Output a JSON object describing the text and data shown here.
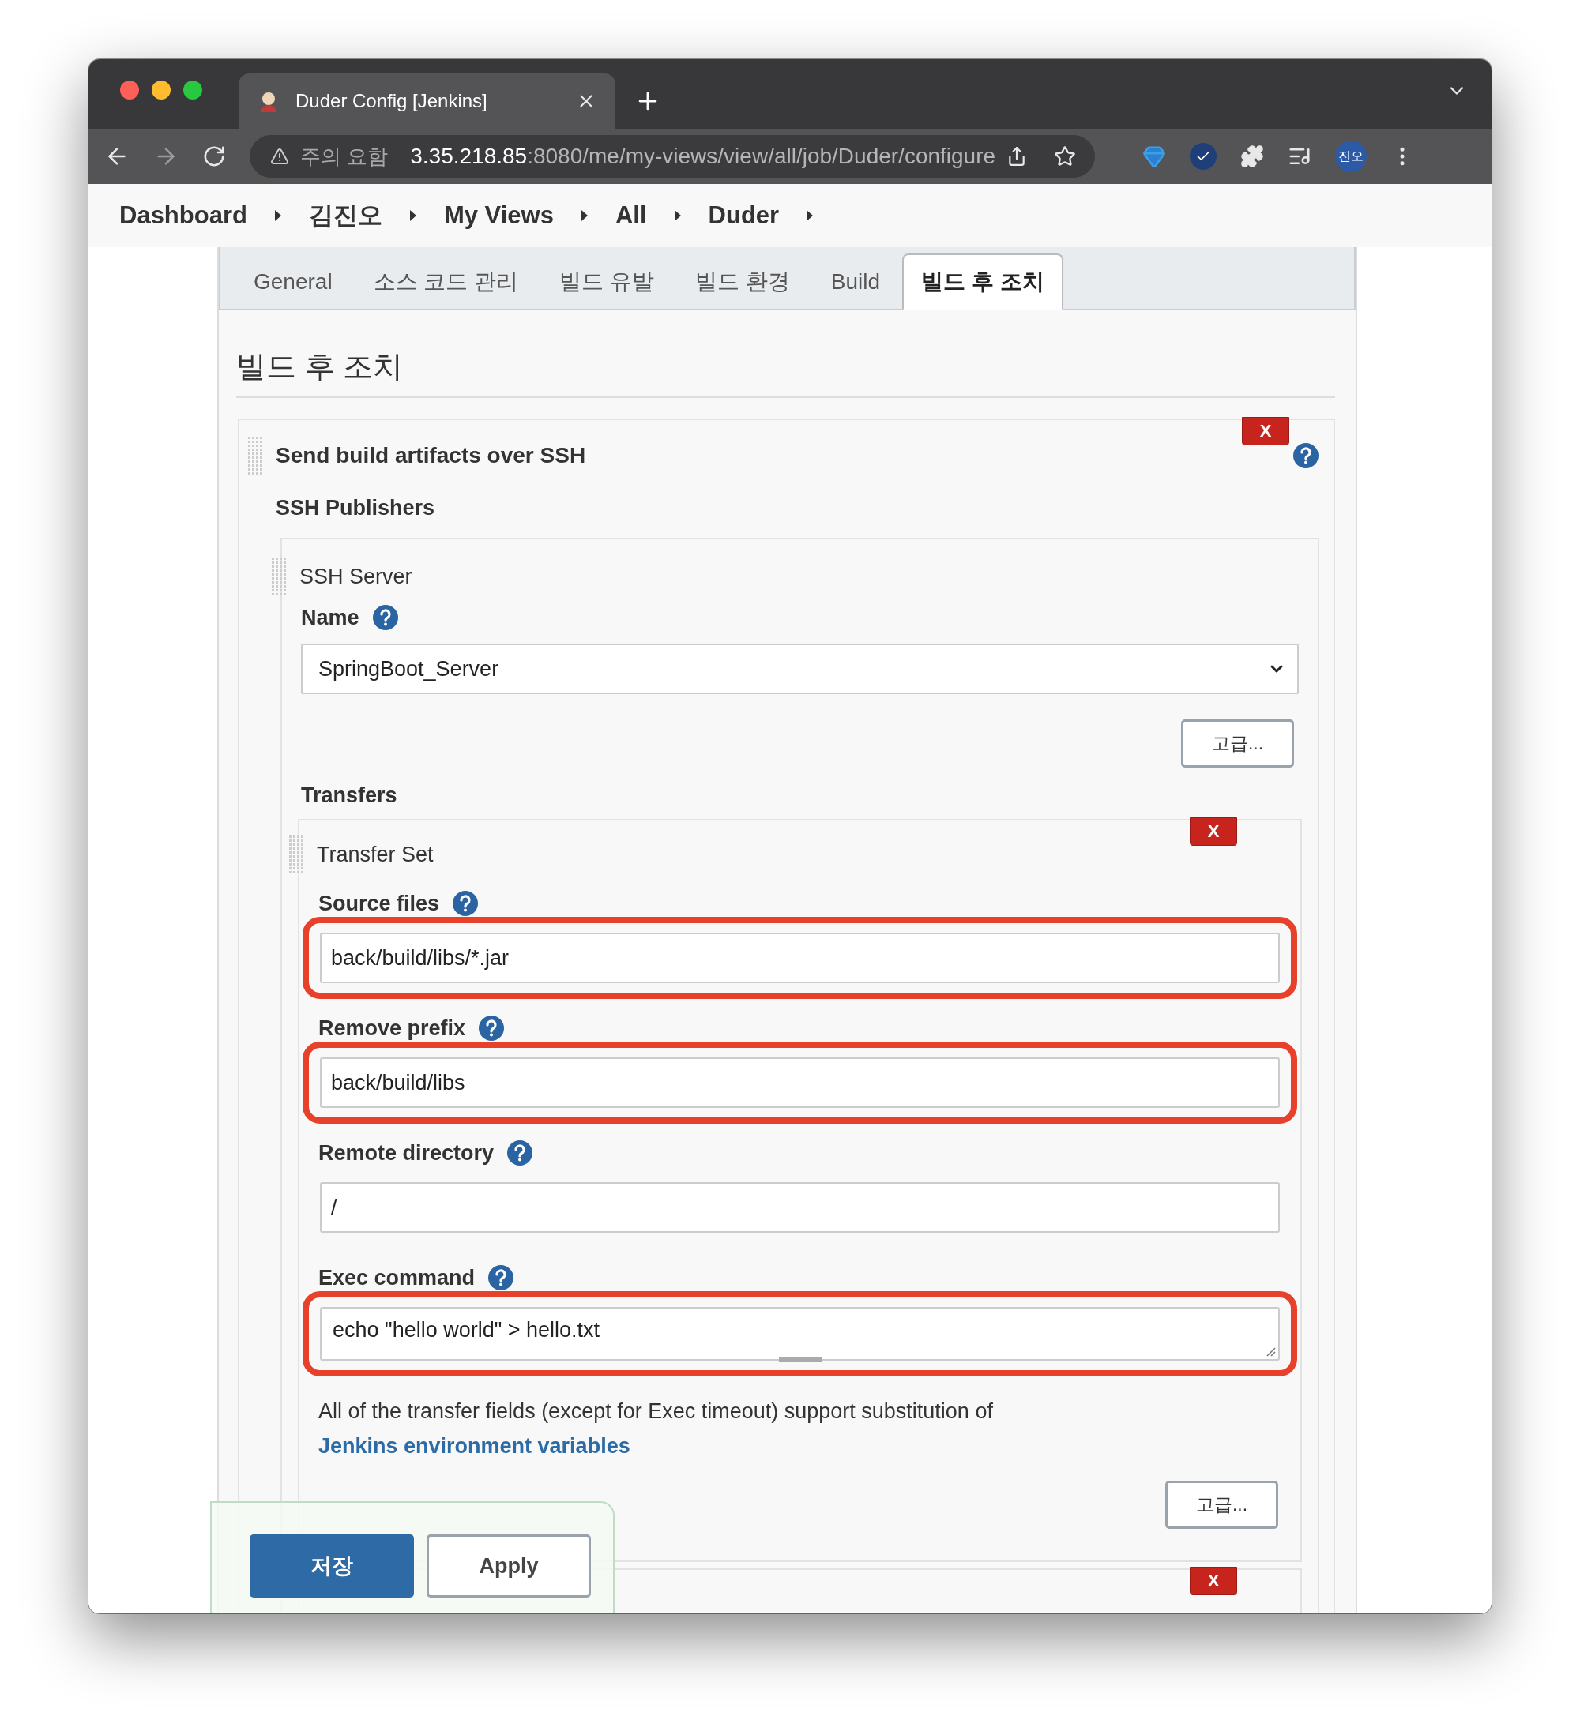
{
  "browser": {
    "tab_title": "Duder Config [Jenkins]",
    "security_label": "주의 요함",
    "url_host": "3.35.218.85",
    "url_path": ":8080/me/my-views/view/all/job/Duder/configure",
    "profile": "진오"
  },
  "breadcrumbs": [
    "Dashboard",
    "김진오",
    "My Views",
    "All",
    "Duder"
  ],
  "tabs": [
    {
      "label": "General",
      "selected": false
    },
    {
      "label": "소스 코드 관리",
      "selected": false
    },
    {
      "label": "빌드 유발",
      "selected": false
    },
    {
      "label": "빌드 환경",
      "selected": false
    },
    {
      "label": "Build",
      "selected": false
    },
    {
      "label": "빌드 후 조치",
      "selected": true
    }
  ],
  "heading": "빌드 후 조치",
  "publisher": {
    "title": "Send build artifacts over SSH",
    "delete": "X",
    "subtitle": "SSH Publishers",
    "server": {
      "title": "SSH Server",
      "name_label": "Name",
      "name_value": "SpringBoot_Server",
      "advanced": "고급...",
      "transfers_label": "Transfers",
      "transfer_sets": [
        {
          "title": "Transfer Set",
          "delete": "X",
          "fields": [
            {
              "label": "Source files",
              "value": "back/build/libs/*.jar",
              "kind": "input",
              "highlighted": true
            },
            {
              "label": "Remove prefix",
              "value": "back/build/libs",
              "kind": "input",
              "highlighted": true
            },
            {
              "label": "Remote directory",
              "value": "/",
              "kind": "input",
              "highlighted": false
            },
            {
              "label": "Exec command",
              "value": "echo \"hello world\" > hello.txt",
              "kind": "textarea",
              "highlighted": true
            }
          ],
          "note": "All of the transfer fields (except for Exec timeout) support substitution of ",
          "note_link": "Jenkins environment variables",
          "advanced": "고급..."
        },
        {
          "delete": "X"
        }
      ]
    }
  },
  "actions": [
    {
      "label": "저장",
      "kind": "primary"
    },
    {
      "label": "Apply",
      "kind": "secondary"
    }
  ]
}
